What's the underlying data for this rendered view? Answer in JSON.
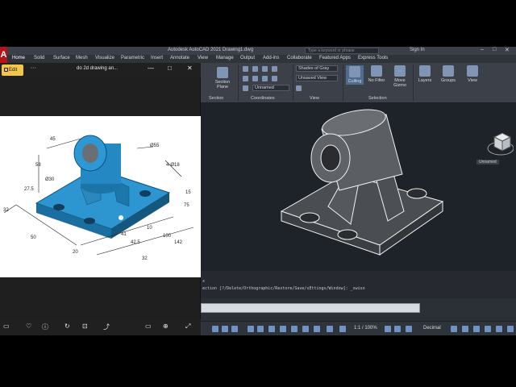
{
  "window": {
    "title": "Autodesk AutoCAD 2021   Drawing1.dwg",
    "search_placeholder": "Type a keyword or phrase",
    "sign_in": "Sign In"
  },
  "ribbon_tabs": [
    "Home",
    "Solid",
    "Surface",
    "Mesh",
    "Visualize",
    "Parametric",
    "Insert",
    "Annotate",
    "View",
    "Manage",
    "Output",
    "Add-ins",
    "Collaborate",
    "Featured Apps",
    "Express Tools"
  ],
  "ribbon": {
    "section_plane": "Section Plane",
    "section_panel": "Section",
    "coordinates_panel": "Coordinates",
    "view_panel": "View",
    "visual_style": "Shades of Gray",
    "unsaved_view": "Unsaved View",
    "unnamed": "Unnamed",
    "culling": "Culling",
    "no_filter": "No Filter",
    "move_gizmo": "Move Gizmo",
    "selection_panel": "Selection",
    "layers": "Layers",
    "groups": "Groups",
    "view_button": "View"
  },
  "photo_viewer": {
    "edit_label": "Edit",
    "dots": "···",
    "file_name": "do 2d drawing an...",
    "minimize": "—",
    "restore": "□",
    "close": "✕"
  },
  "drawing": {
    "dim_labels": [
      "45",
      "58",
      "Ø55",
      "Ø30",
      "27.5",
      "4-Ø18",
      "15",
      "75",
      "50",
      "41",
      "10",
      "42.5",
      "100",
      "142",
      "20",
      "32",
      "32"
    ]
  },
  "viewcube": {
    "label": "Unnamed"
  },
  "command_line": {
    "history": "ection [?/Delete/Orthographic/Restore/Save/sEttings/Window]: _swiso",
    "prompt": "",
    "close_marker": "x"
  },
  "status_bar": {
    "scale": "1:1 / 100%",
    "units": "Decimal"
  },
  "colors": {
    "part_blue": "#1f7fb8",
    "cad_background": "#1e2229",
    "edit_button": "#f3c64b",
    "autocad_red": "#b5121b"
  }
}
